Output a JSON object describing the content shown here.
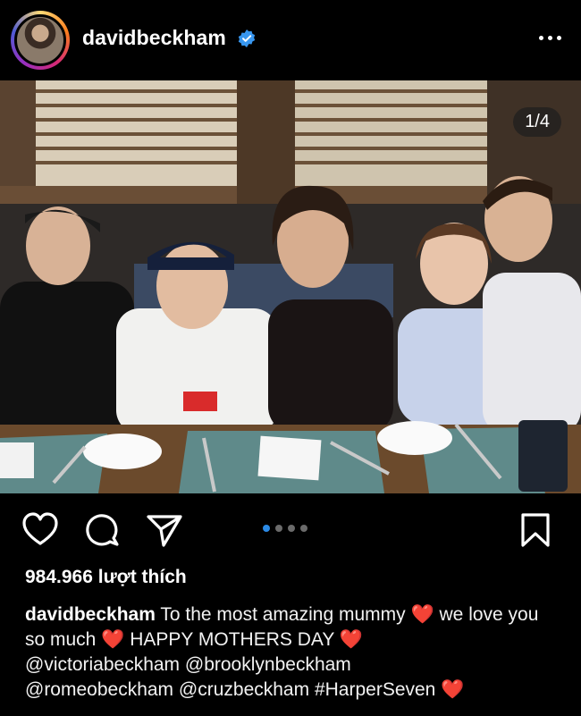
{
  "post": {
    "username": "davidbeckham",
    "verified_icon": "verified-badge-icon",
    "slide_counter": "1/4",
    "likes_text": "984.966 lượt thích",
    "caption": {
      "author": "davidbeckham",
      "line1": "To the most amazing mummy",
      "line1_end": "we",
      "line2": "love you so much",
      "line2_mid": "HAPPY MOTHERS DAY",
      "mention1": "@victoriabeckham",
      "mention2": "@brooklynbeckham",
      "mention3": "@romeobeckham",
      "mention4": "@cruzbeckham",
      "hashtag": "#HarperSeven",
      "heart": "❤️"
    },
    "carousel": {
      "total": 4,
      "current": 1
    }
  },
  "colors": {
    "background": "#000000",
    "accent": "#2b8ae6",
    "verified": "#3897f0",
    "heart": "#e8352f"
  },
  "icons": [
    "like-icon",
    "comment-icon",
    "share-icon",
    "save-icon",
    "more-options-icon"
  ]
}
